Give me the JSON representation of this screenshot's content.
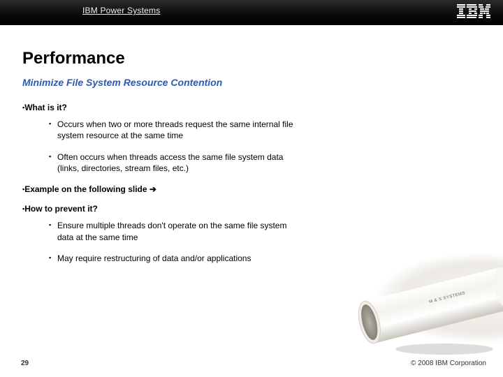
{
  "header": {
    "brand": "IBM Power Systems",
    "logo_name": "ibm-logo"
  },
  "title": "Performance",
  "subtitle": "Minimize File System Resource Contention",
  "sections": [
    {
      "heading": "What is it?",
      "items": [
        "Occurs when two or more threads request the same internal file system resource at the same time",
        "Often occurs when threads access the same file system data (links, directories, stream files, etc.)"
      ]
    },
    {
      "heading": "Example on the following slide ",
      "arrow": "➔",
      "items": []
    },
    {
      "heading": "How to prevent it?",
      "items": [
        "Ensure multiple threads don't operate on the same file system data at the same time",
        "May require restructuring of data and/or applications"
      ]
    }
  ],
  "footer": {
    "page": "29",
    "copyright": "© 2008 IBM Corporation"
  },
  "decorative": {
    "image_alt": "white-pipe-illustration"
  }
}
